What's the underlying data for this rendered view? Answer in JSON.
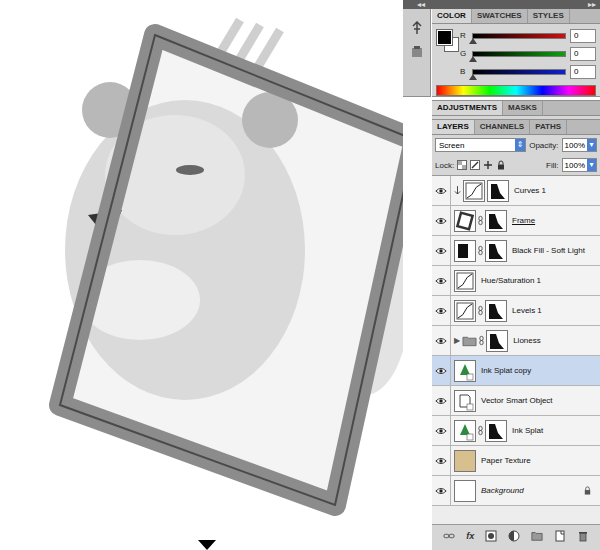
{
  "top_bar": {
    "collapse_left": "◂◂",
    "collapse_right": "▸▸"
  },
  "color_tabs": [
    {
      "label": "COLOR",
      "selected": true
    },
    {
      "label": "SWATCHES",
      "selected": false
    },
    {
      "label": "STYLES",
      "selected": false
    }
  ],
  "color_channels": [
    {
      "name": "R",
      "value": "0",
      "level": 0,
      "color": "#d01010"
    },
    {
      "name": "G",
      "value": "0",
      "level": 0,
      "color": "#10a010"
    },
    {
      "name": "B",
      "value": "0",
      "level": 0,
      "color": "#1020d0"
    }
  ],
  "adjustment_tabs": [
    {
      "label": "ADJUSTMENTS",
      "selected": true
    },
    {
      "label": "MASKS",
      "selected": false
    }
  ],
  "layer_tabs": [
    {
      "label": "LAYERS",
      "selected": true
    },
    {
      "label": "CHANNELS",
      "selected": false
    },
    {
      "label": "PATHS",
      "selected": false
    }
  ],
  "blend_mode": "Screen",
  "opacity": {
    "label": "Opacity:",
    "value": "100%"
  },
  "lock_label": "Lock:",
  "fill": {
    "label": "Fill:",
    "value": "100%"
  },
  "layers": [
    {
      "name": "Curves 1",
      "kind": "adjustment",
      "visible": true,
      "selected": false,
      "clipped": true,
      "mask": true,
      "linked_mask": false,
      "underlined": false,
      "locked": false,
      "toggle": ""
    },
    {
      "name": "Frame",
      "kind": "pixel",
      "visible": true,
      "selected": false,
      "clipped": false,
      "mask": true,
      "linked_mask": true,
      "underlined": true,
      "locked": false,
      "toggle": ""
    },
    {
      "name": "Black Fill - Soft Light",
      "kind": "fill",
      "visible": true,
      "selected": false,
      "clipped": false,
      "mask": true,
      "linked_mask": true,
      "underlined": false,
      "locked": false,
      "toggle": ""
    },
    {
      "name": "Hue/Saturation 1",
      "kind": "adjustment",
      "visible": true,
      "selected": false,
      "clipped": false,
      "mask": false,
      "linked_mask": false,
      "underlined": false,
      "locked": false,
      "toggle": ""
    },
    {
      "name": "Levels 1",
      "kind": "adjustment",
      "visible": true,
      "selected": false,
      "clipped": false,
      "mask": true,
      "linked_mask": true,
      "underlined": false,
      "locked": false,
      "toggle": ""
    },
    {
      "name": "Lioness",
      "kind": "group",
      "visible": true,
      "selected": false,
      "clipped": false,
      "mask": true,
      "linked_mask": true,
      "underlined": false,
      "locked": false,
      "toggle": "▶"
    },
    {
      "name": "Ink Splat copy",
      "kind": "smart",
      "visible": true,
      "selected": true,
      "clipped": false,
      "mask": false,
      "linked_mask": false,
      "underlined": false,
      "locked": false,
      "toggle": ""
    },
    {
      "name": "Vector Smart Object",
      "kind": "vector",
      "visible": true,
      "selected": false,
      "clipped": false,
      "mask": false,
      "linked_mask": false,
      "underlined": false,
      "locked": false,
      "toggle": ""
    },
    {
      "name": "Ink Splat",
      "kind": "smart",
      "visible": true,
      "selected": false,
      "clipped": false,
      "mask": true,
      "linked_mask": true,
      "underlined": false,
      "locked": false,
      "toggle": ""
    },
    {
      "name": "Paper Texture",
      "kind": "texture",
      "visible": true,
      "selected": false,
      "clipped": false,
      "mask": false,
      "linked_mask": false,
      "underlined": false,
      "locked": false,
      "toggle": ""
    },
    {
      "name": "Background",
      "kind": "background",
      "visible": true,
      "selected": false,
      "clipped": false,
      "mask": false,
      "linked_mask": false,
      "underlined": false,
      "locked": true,
      "toggle": ""
    }
  ],
  "footer_fx": "fx"
}
